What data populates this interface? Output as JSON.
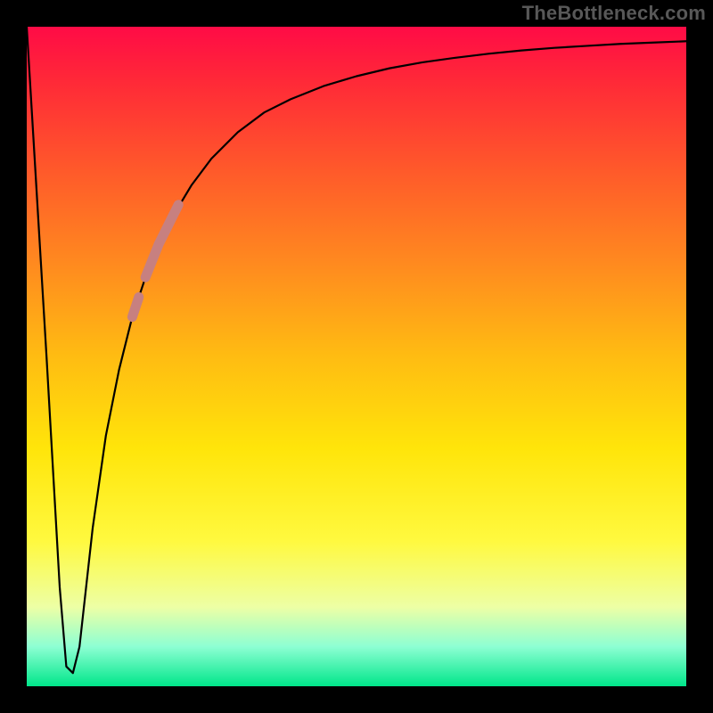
{
  "attribution": "TheBottleneck.com",
  "colors": {
    "page_bg": "#000000",
    "attribution_text": "#585858",
    "curve_stroke": "#000000",
    "highlight_stroke": "#c78080",
    "gradient_top": "#ff0b46",
    "gradient_bottom": "#00e68a"
  },
  "chart_data": {
    "type": "line",
    "title": "",
    "xlabel": "",
    "ylabel": "",
    "xlim": [
      0,
      100
    ],
    "ylim": [
      0,
      100
    ],
    "grid": false,
    "legend": false,
    "series": [
      {
        "name": "bottleneck-curve",
        "x": [
          0,
          3,
          5,
          6,
          7,
          8,
          9,
          10,
          12,
          14,
          16,
          18,
          20,
          22,
          25,
          28,
          32,
          36,
          40,
          45,
          50,
          55,
          60,
          65,
          70,
          75,
          80,
          85,
          90,
          95,
          100
        ],
        "values": [
          100,
          50,
          15,
          3,
          2,
          6,
          15,
          24,
          38,
          48,
          56,
          62,
          67,
          71,
          76,
          80,
          84,
          87,
          89,
          91,
          92.5,
          93.7,
          94.6,
          95.3,
          95.9,
          96.4,
          96.8,
          97.1,
          97.4,
          97.6,
          97.8
        ]
      },
      {
        "name": "highlight-segment",
        "x": [
          16,
          17,
          18,
          19,
          20,
          21,
          22,
          23
        ],
        "values": [
          56,
          59,
          62,
          64.5,
          67,
          69,
          71,
          73
        ]
      }
    ],
    "annotations": []
  }
}
